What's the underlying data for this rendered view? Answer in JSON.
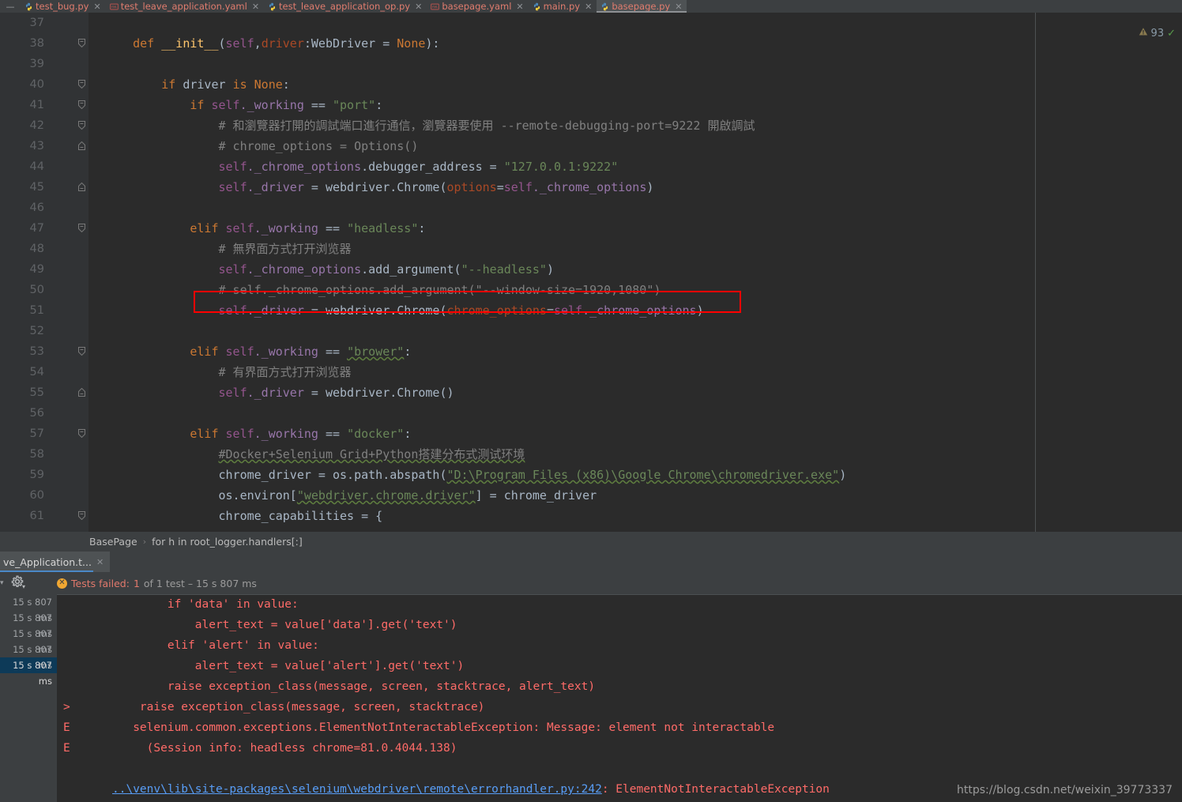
{
  "tabbar": {
    "collapse_label": "—",
    "tabs": [
      {
        "label": "test_bug.py",
        "icon": "python-file-icon",
        "close": "✕",
        "active": false,
        "type": "py"
      },
      {
        "label": "test_leave_application.yaml",
        "icon": "yaml-file-icon",
        "close": "✕",
        "active": false,
        "type": "yml"
      },
      {
        "label": "test_leave_application_op.py",
        "icon": "python-file-icon",
        "close": "✕",
        "active": false,
        "type": "py"
      },
      {
        "label": "basepage.yaml",
        "icon": "yaml-file-icon",
        "close": "✕",
        "active": false,
        "type": "yml"
      },
      {
        "label": "main.py",
        "icon": "python-file-icon",
        "close": "✕",
        "active": false,
        "type": "py"
      },
      {
        "label": "basepage.py",
        "icon": "python-file-icon",
        "close": "✕",
        "active": true,
        "type": "py"
      }
    ]
  },
  "editor": {
    "inspection": {
      "warning_icon": "warning-triangle-icon",
      "warning_count": "93",
      "check_icon": "✓"
    },
    "first_line_number": 37,
    "lines": [
      {
        "n": "37",
        "fold": false,
        "indents": 0
      },
      {
        "n": "38",
        "fold": true,
        "indents": 0
      },
      {
        "n": "39",
        "fold": false,
        "indents": 0
      },
      {
        "n": "40",
        "fold": true,
        "indents": 1
      },
      {
        "n": "41",
        "fold": true,
        "indents": 2
      },
      {
        "n": "42",
        "fold": true,
        "indents": 3
      },
      {
        "n": "43",
        "fold": true,
        "indents": 3
      },
      {
        "n": "44",
        "fold": false,
        "indents": 3
      },
      {
        "n": "45",
        "fold": true,
        "indents": 3
      },
      {
        "n": "46",
        "fold": false,
        "indents": 2
      },
      {
        "n": "47",
        "fold": true,
        "indents": 2
      },
      {
        "n": "48",
        "fold": false,
        "indents": 3
      },
      {
        "n": "49",
        "fold": false,
        "indents": 3
      },
      {
        "n": "50",
        "fold": false,
        "indents": 3
      },
      {
        "n": "51",
        "fold": false,
        "indents": 3
      },
      {
        "n": "52",
        "fold": false,
        "indents": 2
      },
      {
        "n": "53",
        "fold": true,
        "indents": 2
      },
      {
        "n": "54",
        "fold": false,
        "indents": 3
      },
      {
        "n": "55",
        "fold": true,
        "indents": 3
      },
      {
        "n": "56",
        "fold": false,
        "indents": 2
      },
      {
        "n": "57",
        "fold": true,
        "indents": 2
      },
      {
        "n": "58",
        "fold": false,
        "indents": 3
      },
      {
        "n": "59",
        "fold": false,
        "indents": 3
      },
      {
        "n": "60",
        "fold": false,
        "indents": 3
      },
      {
        "n": "61",
        "fold": true,
        "indents": 3
      }
    ],
    "code_text": {
      "l38": "    def __init__(self,driver:WebDriver = None):",
      "l40": "        if driver is None:",
      "l41": "            if self._working == \"port\":",
      "l42": "                # 和瀏覽器打開的調試端口進行通信，瀏覽器要使用 --remote-debugging-port=9222 開啟調試",
      "l43": "                # chrome_options = Options()",
      "l44": "                self._chrome_options.debugger_address = \"127.0.0.1:9222\"",
      "l45": "                self._driver = webdriver.Chrome(options=self._chrome_options)",
      "l47": "            elif self._working == \"headless\":",
      "l48": "                # 無界面方式打开浏览器",
      "l49": "                self._chrome_options.add_argument(\"--headless\")",
      "l50": "                # self._chrome_options.add_argument(\"--window-size=1920,1080\")",
      "l51": "                self._driver = webdriver.Chrome(chrome_options=self._chrome_options)",
      "l53": "            elif self._working == \"brower\":",
      "l54": "                # 有界面方式打开浏览器",
      "l55": "                self._driver = webdriver.Chrome()",
      "l57": "            elif self._working == \"docker\":",
      "l58": "                #Docker+Selenium Grid+Python搭建分布式测试环境",
      "l59": "                chrome_driver = os.path.abspath(\"D:\\Program Files (x86)\\Google Chrome\\chromedriver.exe\")",
      "l60": "                os.environ[\"webdriver.chrome.driver\"] = chrome_driver",
      "l61": "                chrome_capabilities = {"
    },
    "highlight_box": {
      "color": "#ff0000",
      "line": "50"
    }
  },
  "breadcrumb": {
    "items": [
      "BasePage",
      "for h in root_logger.handlers[:]"
    ],
    "separator": "›"
  },
  "run_panel": {
    "tab": {
      "label": "ve_Application.t...",
      "close": "✕"
    },
    "toolbar": {
      "gear_icon": "gear-icon",
      "caret_icon": "chevron-down-icon"
    },
    "status": {
      "fail_icon": "error-circle-icon",
      "fail_mark": "✕",
      "label": "Tests failed:",
      "count": "1",
      "suffix": "of 1 test – 15 s 807 ms"
    },
    "timestamps": [
      {
        "t": "15 s 807 ms",
        "selected": false
      },
      {
        "t": "15 s 807 ms",
        "selected": false
      },
      {
        "t": "15 s 807 ms",
        "selected": false
      },
      {
        "t": "15 s 807 ms",
        "selected": false
      },
      {
        "t": "15 s 807 ms",
        "selected": true
      }
    ],
    "console_lines": [
      {
        "marker": "",
        "text": "        if 'data' in value:"
      },
      {
        "marker": "",
        "text": "            alert_text = value['data'].get('text')"
      },
      {
        "marker": "",
        "text": "        elif 'alert' in value:"
      },
      {
        "marker": "",
        "text": "            alert_text = value['alert'].get('text')"
      },
      {
        "marker": "",
        "text": "        raise exception_class(message, screen, stacktrace, alert_text)"
      },
      {
        "marker": ">",
        "text": "    raise exception_class(message, screen, stacktrace)"
      },
      {
        "marker": "E",
        "text": "   selenium.common.exceptions.ElementNotInteractableException: Message: element not interactable"
      },
      {
        "marker": "E",
        "text": "     (Session info: headless chrome=81.0.4044.138)"
      }
    ],
    "error_link": {
      "path": "..\\venv\\lib\\site-packages\\selenium\\webdriver\\remote\\errorhandler.py:242",
      "suffix": ": ElementNotInteractableException"
    }
  },
  "watermark": {
    "text": "https://blog.csdn.net/weixin_39773337"
  },
  "colors": {
    "editor_bg": "#2b2b2b",
    "chrome_bg": "#3c3f41",
    "accent_blue": "#4a88c7",
    "error_red": "#ff6b68",
    "highlight_red": "#ff0000",
    "string_green": "#6a8759",
    "keyword_orange": "#cc7832"
  }
}
